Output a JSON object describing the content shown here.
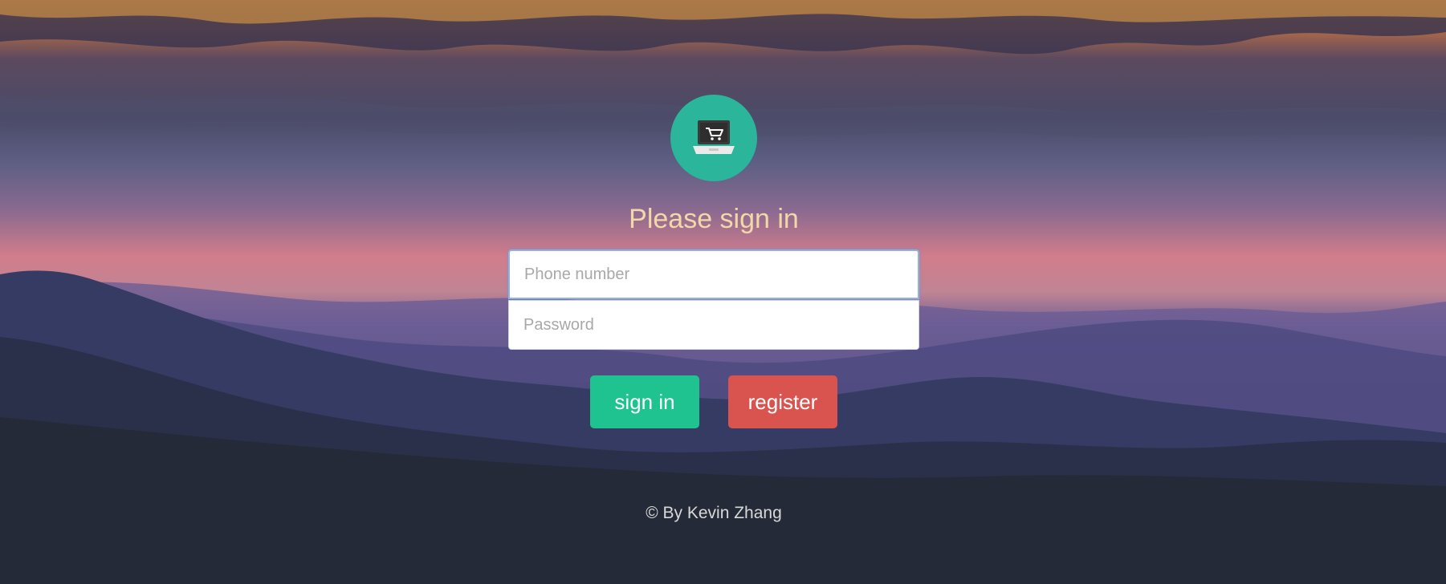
{
  "login": {
    "heading": "Please sign in",
    "phone_placeholder": "Phone number",
    "phone_value": "",
    "password_placeholder": "Password",
    "password_value": "",
    "signin_label": "sign in",
    "register_label": "register",
    "footer": "© By Kevin Zhang"
  },
  "logo": {
    "icon": "laptop-cart-icon"
  },
  "colors": {
    "logo_bg": "#2bb59a",
    "heading": "#f2d7a8",
    "signin_button": "#1fc38f",
    "register_button": "#d9534f",
    "footer_text": "#d8d8d8"
  }
}
